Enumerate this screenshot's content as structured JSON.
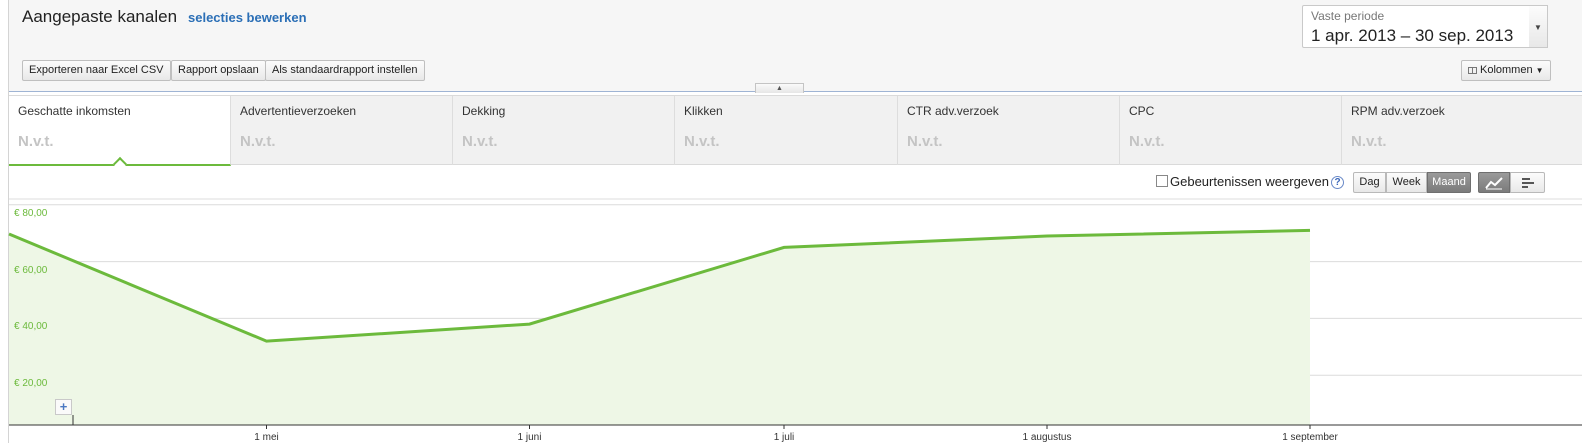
{
  "header": {
    "title": "Aangepaste kanalen",
    "edit_link": "selecties bewerken",
    "buttons": {
      "export": "Exporteren naar Excel CSV",
      "save": "Rapport opslaan",
      "default": "Als standaardrapport instellen"
    },
    "period": {
      "label": "Vaste periode",
      "value": "1 apr. 2013 – 30 sep. 2013"
    },
    "columns_button": "Kolommen"
  },
  "metrics": [
    {
      "label": "Geschatte inkomsten",
      "value": "N.v.t."
    },
    {
      "label": "Advertentieverzoeken",
      "value": "N.v.t."
    },
    {
      "label": "Dekking",
      "value": "N.v.t."
    },
    {
      "label": "Klikken",
      "value": "N.v.t."
    },
    {
      "label": "CTR adv.verzoek",
      "value": "N.v.t."
    },
    {
      "label": "CPC",
      "value": "N.v.t."
    },
    {
      "label": "RPM adv.verzoek",
      "value": "N.v.t."
    }
  ],
  "controls": {
    "events_label": "Gebeurtenissen weergeven",
    "granularity": [
      "Dag",
      "Week",
      "Maand"
    ],
    "granularity_selected": "Maand",
    "view_selected": "line-chart"
  },
  "colors": {
    "series": "#6cba3c",
    "series_fill": "#eef7e6",
    "link": "#2b6fb6"
  },
  "chart_data": {
    "type": "area",
    "y_ticks": [
      "€ 80,00",
      "€ 60,00",
      "€ 40,00",
      "€ 20,00"
    ],
    "y_tick_values": [
      80,
      60,
      40,
      20
    ],
    "x_ticks": [
      "1 mei",
      "1 juni",
      "1 juli",
      "1 augustus",
      "1 september"
    ],
    "x": [
      "2013-04-01",
      "2013-05-01",
      "2013-06-01",
      "2013-07-01",
      "2013-08-01",
      "2013-09-01"
    ],
    "values": [
      69,
      32,
      38,
      65,
      69,
      71
    ],
    "ylim": [
      0,
      90
    ],
    "grid": true
  }
}
